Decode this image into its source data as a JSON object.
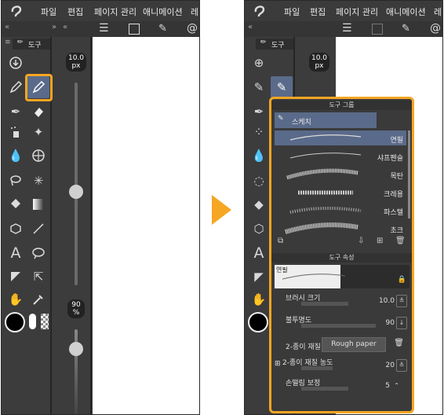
{
  "menu": {
    "items": [
      "파일",
      "편집",
      "페이지 관리",
      "애니메이션",
      "레이"
    ]
  },
  "left_panel": {
    "tab_label": "도구",
    "brush_size": "10.0",
    "brush_unit": "px",
    "opacity": "90",
    "opacity_unit": "%"
  },
  "right_panel": {
    "tab_label": "도구",
    "brush_size": "10.0",
    "brush_unit": "px"
  },
  "sub_tool": {
    "group_title": "도구 그룹",
    "group_name": "스케치",
    "brushes": [
      "연필",
      "샤프펜슬",
      "목탄",
      "크레용",
      "파스텔",
      "초크"
    ],
    "selected_brush": "연필"
  },
  "tool_property": {
    "title": "도구 속성",
    "preview_label": "연필",
    "brush_size_label": "브러시 크기",
    "brush_size_value": "10.0",
    "opacity_label": "불투명도",
    "opacity_value": "90",
    "paper_label": "2-종이 재질",
    "paper_value": "Rough paper",
    "paper_density_label": "2-종이 재질 농도",
    "paper_density_value": "20",
    "stabilization_label": "손떨림 보정",
    "stabilization_value": "5"
  },
  "colors": {
    "accent": "#f5a623",
    "panel": "#3c3c3c",
    "selected": "#5a6a8a"
  }
}
